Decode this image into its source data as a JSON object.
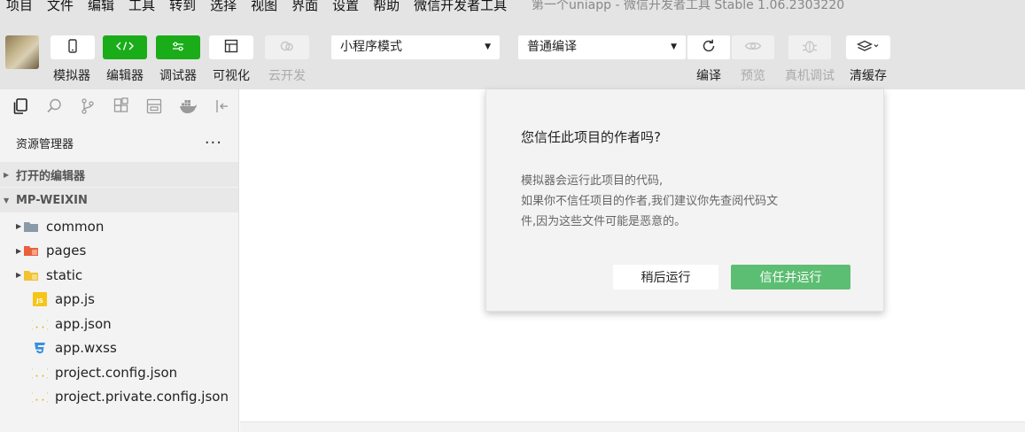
{
  "menubar": {
    "items": [
      "项目",
      "文件",
      "编辑",
      "工具",
      "转到",
      "选择",
      "视图",
      "界面",
      "设置",
      "帮助",
      "微信开发者工具"
    ],
    "window_title": "第一个uniapp - 微信开发者工具 Stable 1.06.2303220"
  },
  "toolbar": {
    "simulator_label": "模拟器",
    "editor_label": "编辑器",
    "debugger_label": "调试器",
    "visual_label": "可视化",
    "cloud_label": "云开发",
    "mode_select": "小程序模式",
    "compile_select": "普通编译",
    "compile_label": "编译",
    "preview_label": "预览",
    "device_debug_label": "真机调试",
    "clear_cache_label": "清缓存",
    "accent_color": "#1aad19"
  },
  "sidebar": {
    "explorer_title": "资源管理器",
    "more": "···",
    "open_editors": "打开的编辑器",
    "project_section": "MP-WEIXIN",
    "tree": [
      {
        "name": "common",
        "type": "folder",
        "icon": "folder-icon"
      },
      {
        "name": "pages",
        "type": "folder",
        "icon": "pages-folder-icon"
      },
      {
        "name": "static",
        "type": "folder",
        "icon": "static-folder-icon"
      },
      {
        "name": "app.js",
        "type": "file",
        "icon": "js-icon"
      },
      {
        "name": "app.json",
        "type": "file",
        "icon": "json-icon"
      },
      {
        "name": "app.wxss",
        "type": "file",
        "icon": "css-icon"
      },
      {
        "name": "project.config.json",
        "type": "file",
        "icon": "json-icon"
      },
      {
        "name": "project.private.config.json",
        "type": "file",
        "icon": "json-icon"
      }
    ]
  },
  "dialog": {
    "title": "您信任此项目的作者吗?",
    "message_lines": [
      "模拟器会运行此项目的代码,",
      "如果你不信任项目的作者,我们建议你先查阅代码文",
      "件,因为这些文件可能是恶意的。"
    ],
    "later_button": "稍后运行",
    "trust_button": "信任并运行",
    "trust_color": "#5cbe72"
  }
}
